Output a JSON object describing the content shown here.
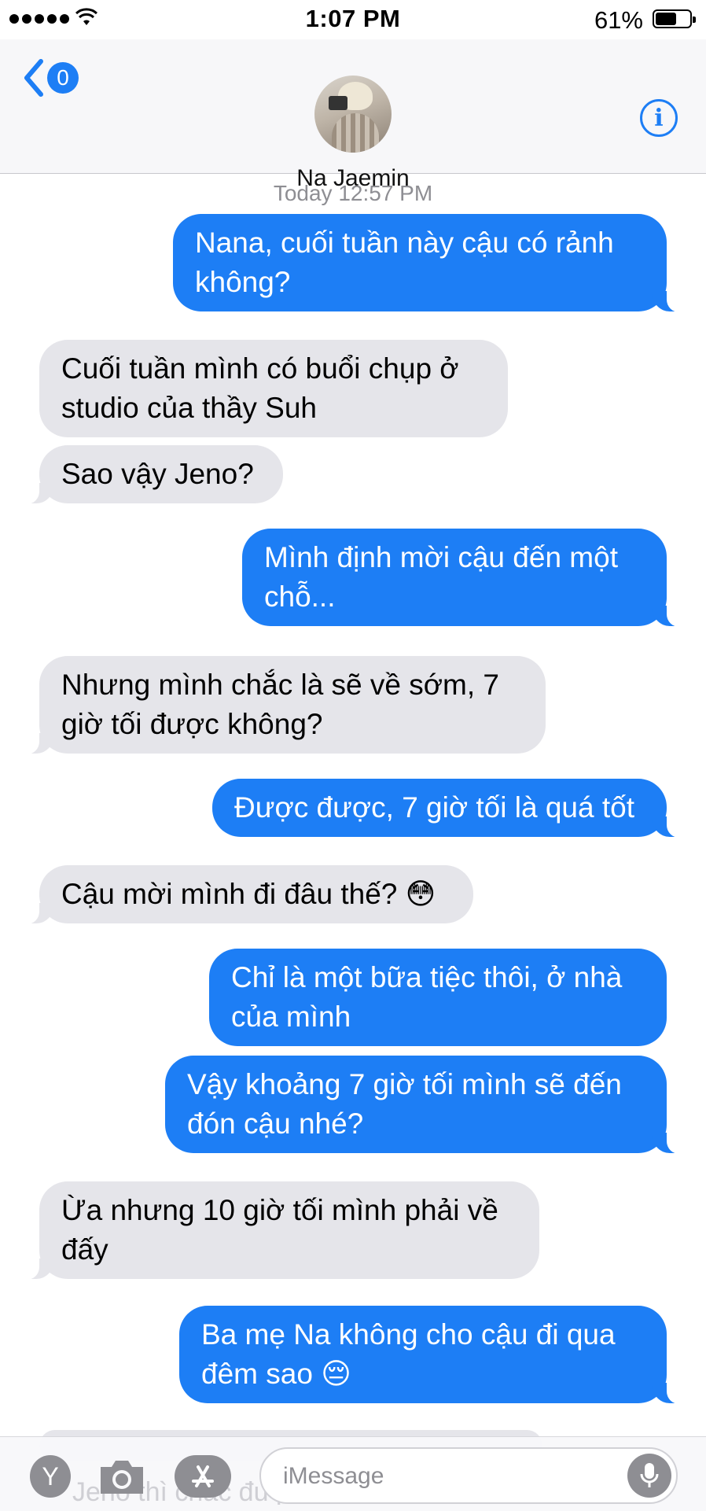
{
  "status_bar": {
    "time": "1:07 PM",
    "battery_percent": "61%",
    "battery_level": 0.61,
    "signal_bars": 5
  },
  "header": {
    "back_badge": "0",
    "contact_name": "Na Jaemin",
    "info_icon": "info-icon"
  },
  "conversation": {
    "timestamp": "Today 12:57 PM",
    "messages": [
      {
        "from": "me",
        "text": "Nana, cuối tuần này cậu có rảnh không?"
      },
      {
        "from": "them",
        "text": "Cuối tuần mình có buổi chụp ở studio của thầy Suh"
      },
      {
        "from": "them",
        "text": "Sao vậy Jeno?"
      },
      {
        "from": "me",
        "text": "Mình định mời cậu đến một chỗ..."
      },
      {
        "from": "them",
        "text": "Nhưng mình chắc là sẽ về sớm, 7 giờ tối được không?"
      },
      {
        "from": "me",
        "text": "Được được, 7 giờ tối là quá tốt"
      },
      {
        "from": "them",
        "text": "Cậu mời mình đi đâu thế? 😳"
      },
      {
        "from": "me",
        "text": "Chỉ là một bữa tiệc thôi, ở nhà của mình"
      },
      {
        "from": "me",
        "text": "Vậy khoảng 7 giờ tối mình sẽ đến đón cậu nhé?"
      },
      {
        "from": "them",
        "text": "Ừa nhưng 10 giờ tối mình phải về đấy"
      },
      {
        "from": "me",
        "text": "Ba mẹ Na không cho cậu đi qua đêm sao 😔"
      }
    ],
    "partial_next": "Jeno thì chắc được"
  },
  "input_bar": {
    "placeholder": "iMessage",
    "y_button_label": "Y",
    "icons": [
      "camera-icon",
      "app-store-icon",
      "microphone-icon"
    ]
  },
  "colors": {
    "sent_bubble": "#1d7ef5",
    "received_bubble": "#e5e5ea",
    "accent": "#1d7ef5"
  }
}
